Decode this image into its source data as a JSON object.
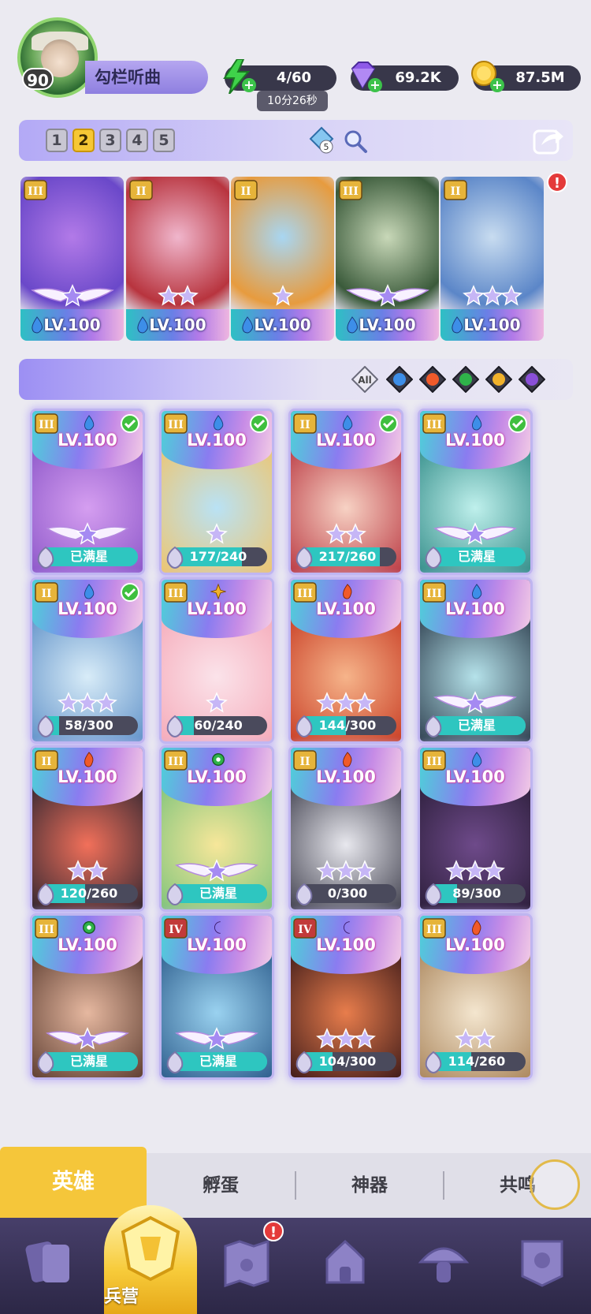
{
  "player": {
    "level": "90",
    "name": "勾栏听曲"
  },
  "resources": {
    "energy": "4/60",
    "energy_timer": "10分26秒",
    "gems": "69.2K",
    "gold": "87.5M"
  },
  "team": {
    "tabs": [
      "1",
      "2",
      "3",
      "4",
      "5"
    ],
    "active_tab": "2",
    "mid_count": "5",
    "alert_mark": "!",
    "slots": [
      {
        "rank": "III",
        "level": "LV.100",
        "stars": 0,
        "wings": true,
        "element": "water",
        "colors": [
          "#b27ae8",
          "#6a48c9"
        ]
      },
      {
        "rank": "II",
        "level": "LV.100",
        "stars": 2,
        "wings": false,
        "element": "water",
        "colors": [
          "#f0b6cc",
          "#b8343e"
        ]
      },
      {
        "rank": "II",
        "level": "LV.100",
        "stars": 1,
        "wings": false,
        "element": "water",
        "colors": [
          "#a8d6f2",
          "#e79b3e"
        ]
      },
      {
        "rank": "III",
        "level": "LV.100",
        "stars": 0,
        "wings": true,
        "element": "water",
        "colors": [
          "#c8d8b8",
          "#3a5a3a"
        ]
      },
      {
        "rank": "II",
        "level": "LV.100",
        "stars": 3,
        "wings": false,
        "element": "water",
        "colors": [
          "#c8dcf0",
          "#5b86c8"
        ]
      }
    ]
  },
  "filters": {
    "all_label": "All",
    "items": [
      "all",
      "water",
      "fire",
      "wind",
      "light",
      "dark"
    ]
  },
  "heroes": [
    {
      "rank": "III",
      "element": "water",
      "level": "LV.100",
      "stars": 0,
      "wings": true,
      "checked": true,
      "progress": "已满星",
      "fill": 1.0,
      "colors": [
        "#d59ef0",
        "#8a55c8"
      ]
    },
    {
      "rank": "III",
      "element": "water",
      "level": "LV.100",
      "stars": 1,
      "wings": false,
      "checked": true,
      "progress": "177/240",
      "fill": 0.74,
      "colors": [
        "#b9e2f5",
        "#f0c46a"
      ]
    },
    {
      "rank": "II",
      "element": "water",
      "level": "LV.100",
      "stars": 2,
      "wings": false,
      "checked": true,
      "progress": "217/260",
      "fill": 0.83,
      "colors": [
        "#f7d2c4",
        "#b8343e"
      ]
    },
    {
      "rank": "III",
      "element": "water",
      "level": "LV.100",
      "stars": 0,
      "wings": true,
      "checked": true,
      "progress": "已满星",
      "fill": 1.0,
      "colors": [
        "#bff0ec",
        "#2f8a86"
      ]
    },
    {
      "rank": "II",
      "element": "water",
      "level": "LV.100",
      "stars": 3,
      "wings": false,
      "checked": true,
      "progress": "58/300",
      "fill": 0.19,
      "colors": [
        "#d8ecf8",
        "#5d8fc7"
      ]
    },
    {
      "rank": "III",
      "element": "light",
      "level": "LV.100",
      "stars": 1,
      "wings": false,
      "checked": false,
      "progress": "60/240",
      "fill": 0.25,
      "colors": [
        "#fbe3ea",
        "#f5a9b8"
      ]
    },
    {
      "rank": "III",
      "element": "fire",
      "level": "LV.100",
      "stars": 3,
      "wings": false,
      "checked": false,
      "progress": "144/300",
      "fill": 0.48,
      "colors": [
        "#f6b48a",
        "#c73a22"
      ]
    },
    {
      "rank": "III",
      "element": "water",
      "level": "LV.100",
      "stars": 0,
      "wings": true,
      "checked": false,
      "progress": "已满星",
      "fill": 1.0,
      "colors": [
        "#b5e2ea",
        "#2a3a4a"
      ]
    },
    {
      "rank": "II",
      "element": "fire",
      "level": "LV.100",
      "stars": 2,
      "wings": false,
      "checked": false,
      "progress": "120/260",
      "fill": 0.46,
      "colors": [
        "#f2705a",
        "#2a2430"
      ]
    },
    {
      "rank": "III",
      "element": "wind",
      "level": "LV.100",
      "stars": 0,
      "wings": true,
      "checked": false,
      "progress": "已满星",
      "fill": 1.0,
      "colors": [
        "#f7e79a",
        "#7ac27a"
      ]
    },
    {
      "rank": "II",
      "element": "fire",
      "level": "LV.100",
      "stars": 3,
      "wings": false,
      "checked": false,
      "progress": "0/300",
      "fill": 0.0,
      "colors": [
        "#e8e8ee",
        "#3a3a48"
      ]
    },
    {
      "rank": "III",
      "element": "water",
      "level": "LV.100",
      "stars": 3,
      "wings": false,
      "checked": false,
      "progress": "89/300",
      "fill": 0.3,
      "colors": [
        "#6e4a8a",
        "#2a1d38"
      ]
    },
    {
      "rank": "III",
      "element": "wind",
      "level": "LV.100",
      "stars": 0,
      "wings": true,
      "checked": false,
      "progress": "已满星",
      "fill": 1.0,
      "colors": [
        "#e6b8a0",
        "#5a3a2e"
      ]
    },
    {
      "rank": "IV",
      "element": "dark",
      "level": "LV.100",
      "stars": 0,
      "wings": true,
      "checked": false,
      "progress": "已满星",
      "fill": 1.0,
      "colors": [
        "#9ad2f0",
        "#2a5a8a"
      ]
    },
    {
      "rank": "IV",
      "element": "dark",
      "level": "LV.100",
      "stars": 3,
      "wings": false,
      "checked": false,
      "progress": "104/300",
      "fill": 0.35,
      "colors": [
        "#e87d4c",
        "#3a1818"
      ]
    },
    {
      "rank": "III",
      "element": "fire",
      "level": "LV.100",
      "stars": 2,
      "wings": false,
      "checked": false,
      "progress": "114/260",
      "fill": 0.44,
      "colors": [
        "#f4e6cf",
        "#a9845a"
      ]
    }
  ],
  "subtabs": {
    "hero": "英雄",
    "hatch": "孵蛋",
    "artifact": "神器",
    "resonance": "共鸣"
  },
  "nav": {
    "barracks": "兵营",
    "alert_mark": "!"
  },
  "colors": {
    "accent": "#f5c63a",
    "water": "#3d8ee8",
    "fire": "#f05a2a",
    "wind": "#2fb34a",
    "light": "#f1b22b",
    "dark": "#8a4fd8",
    "check": "#3fbf3f"
  }
}
